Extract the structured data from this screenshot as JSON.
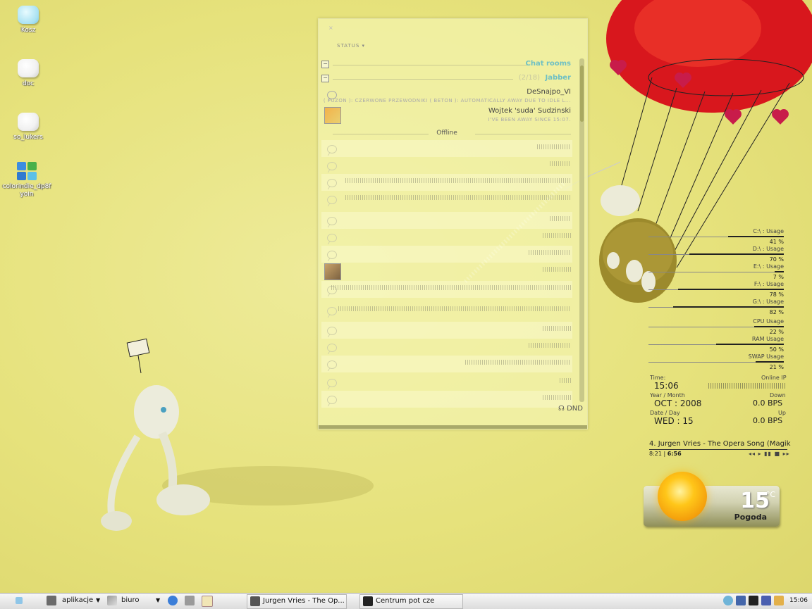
{
  "desktop_icons": [
    {
      "label": "Kosz",
      "icon": "trash-icon"
    },
    {
      "label": "doc",
      "icon": "folder-icon"
    },
    {
      "label": "so_lukers",
      "icon": "folder-icon"
    },
    {
      "label": "colorindie_dp8f yoin",
      "icon": "windows-app-icon"
    }
  ],
  "chat": {
    "close_label": "×",
    "status_label": "STATUS ▾",
    "groups": [
      {
        "toggle": "−",
        "name": "Chat rooms",
        "count": ""
      },
      {
        "toggle": "−",
        "name": "Jabber",
        "count": "(2/18)"
      }
    ],
    "contacts": [
      {
        "name": "DeSnajpo_VI",
        "status": "( PUZON ): CZERWONE PRZEWODNIKI ( BETON ): AUTOMATICALLY AWAY DUE TO IDLE L..."
      },
      {
        "name": "Wojtek 'suda' Sudzinski",
        "status": "I'VE BEEN AWAY SINCE 15:07."
      }
    ],
    "offline_label": "Offline",
    "dnd_label": "DND"
  },
  "monitor": [
    {
      "label": "C:\\ : Usage",
      "value": "41 %",
      "pct": 41
    },
    {
      "label": "D:\\ : Usage",
      "value": "70 %",
      "pct": 70
    },
    {
      "label": "E:\\ : Usage",
      "value": "7 %",
      "pct": 7
    },
    {
      "label": "F:\\ : Usage",
      "value": "78 %",
      "pct": 78
    },
    {
      "label": "G:\\ : Usage",
      "value": "82 %",
      "pct": 82
    },
    {
      "label": "CPU Usage",
      "value": "22 %",
      "pct": 22
    },
    {
      "label": "RAM Usage",
      "value": "50 %",
      "pct": 50
    },
    {
      "label": "SWAP Usage",
      "value": "21 %",
      "pct": 21
    }
  ],
  "clock": {
    "time_label": "Time:",
    "time": "15:06",
    "online_ip_label": "Online IP",
    "year_month_label": "Year / Month",
    "year_month": "OCT : 2008",
    "down_label": "Down",
    "down": "0.0 BPS",
    "date_day_label": "Date / Day",
    "date_day": "WED : 15",
    "up_label": "Up",
    "up": "0.0 BPS"
  },
  "player": {
    "track": "4. Jurgen Vries - The Opera Song (Magik",
    "position": "8:21",
    "duration": "6:56",
    "controls": "◂◂ ▸ ▮▮ ■ ▸▸"
  },
  "weather": {
    "temp": "15",
    "deg": "°C",
    "place": "Pogoda"
  },
  "taskbar": {
    "menu1": "aplikacje",
    "menu2": "biuro",
    "task1": "Jurgen Vries - The Op...",
    "task2": "Centrum pot cze",
    "clock": "15:06"
  }
}
